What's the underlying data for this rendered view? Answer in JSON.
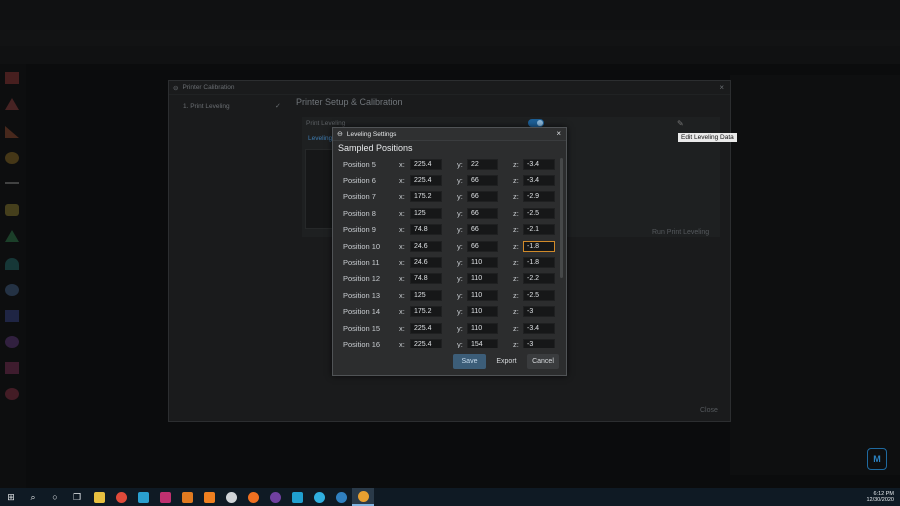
{
  "calibration_dialog": {
    "title": "Printer Calibration",
    "step": "1. Print Leveling",
    "heading": "Printer Setup & Calibration",
    "panel_label": "Print Leveling",
    "tab_label": "Leveling",
    "run_label": "Run Print Leveling",
    "close_label": "Close",
    "tooltip": "Edit Leveling Data"
  },
  "leveling_dialog": {
    "title": "Leveling Settings",
    "heading": "Sampled Positions",
    "axis_x": "x:",
    "axis_y": "y:",
    "axis_z": "z:",
    "positions": [
      {
        "label": "Position 5",
        "x": "225.4",
        "y": "22",
        "z": "-3.4"
      },
      {
        "label": "Position 6",
        "x": "225.4",
        "y": "66",
        "z": "-3.4"
      },
      {
        "label": "Position 7",
        "x": "175.2",
        "y": "66",
        "z": "-2.9"
      },
      {
        "label": "Position 8",
        "x": "125",
        "y": "66",
        "z": "-2.5"
      },
      {
        "label": "Position 9",
        "x": "74.8",
        "y": "66",
        "z": "-2.1"
      },
      {
        "label": "Position 10",
        "x": "24.6",
        "y": "66",
        "z": "-1.8"
      },
      {
        "label": "Position 11",
        "x": "24.6",
        "y": "110",
        "z": "-1.8"
      },
      {
        "label": "Position 12",
        "x": "74.8",
        "y": "110",
        "z": "-2.2"
      },
      {
        "label": "Position 13",
        "x": "125",
        "y": "110",
        "z": "-2.5"
      },
      {
        "label": "Position 14",
        "x": "175.2",
        "y": "110",
        "z": "-3"
      },
      {
        "label": "Position 15",
        "x": "225.4",
        "y": "110",
        "z": "-3.4"
      },
      {
        "label": "Position 16",
        "x": "225.4",
        "y": "154",
        "z": "-3"
      }
    ],
    "save_label": "Save",
    "export_label": "Export",
    "cancel_label": "Cancel"
  },
  "taskbar": {
    "time": "6:12 PM",
    "date": "12/30/2020"
  },
  "colors": {
    "accent": "#3c5d78",
    "focus_outline": "#d08a2a",
    "toggle_on": "#1d5f96"
  }
}
